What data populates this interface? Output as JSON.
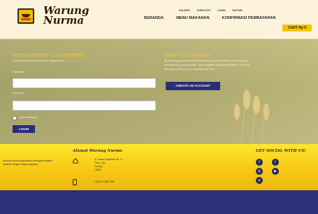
{
  "brand": {
    "line1": "Warung",
    "line2": "Nurma"
  },
  "top_links": [
    "KOLEKSI",
    "CHECKOUT",
    "LOGIN",
    "DAFTAR"
  ],
  "nav": [
    "BERANDA",
    "MENU MAKANAN",
    "KONFIRMASI PEMBAYARAN"
  ],
  "cart_label": "CART Rp 0",
  "registered": {
    "title": "REGISTERED CUSTOMERS",
    "subtitle": "If you have an account with us, please log in.",
    "username_label": "Username",
    "password_label": "Password",
    "remember_label": "Lihat Password",
    "login_button": "LOGIN"
  },
  "new_customer": {
    "title": "NEW CUSTOMER",
    "body_1": "By creating an account with our store, you will be able to move through",
    "body_2": "the checkout process faster, store multiple shipping addresses, view and",
    "body_3": "track your orders in your account and more.",
    "button": "CREATE AN ACCOUNT"
  },
  "footer": {
    "about_1": "Warung Nurma menyediakan berbagai masakan",
    "about_2": "rumahan dengan harga terjangkau.",
    "address_title": "Alamat Warung Nurma",
    "address_lines": [
      "Jl. Jendral Sudirman No. 17",
      "Town, City",
      "Country",
      "12345"
    ],
    "phone": "+62 812 3456 7890",
    "social_title": "GET SOCIAL WITH US!"
  },
  "colors": {
    "header_bg": "#fdf3dc",
    "accent_yellow": "#f5c400",
    "button_navy": "#2a2e78",
    "footer_bottom": "#2e2f7a"
  }
}
